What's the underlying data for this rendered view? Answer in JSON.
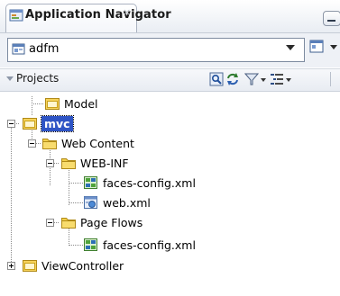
{
  "tab": {
    "title": "Application Navigator",
    "close_glyph": "×",
    "icon": "application-navigator-icon"
  },
  "app_selector": {
    "value": "adfm",
    "icon": "application-icon"
  },
  "projects_panel": {
    "title": "Projects",
    "toolbar": [
      "open-project-icon",
      "refresh-icon",
      "filter-icon",
      "sort-options-icon"
    ]
  },
  "tree": {
    "mvc": "mvc",
    "model": "Model",
    "web_content": "Web Content",
    "web_inf": "WEB-INF",
    "faces_config_1": "faces-config.xml",
    "web_xml": "web.xml",
    "page_flows": "Page Flows",
    "faces_config_2": "faces-config.xml",
    "view_controller": "ViewController"
  },
  "colors": {
    "selection": "#2f55c5",
    "folder": "#f2cf4a",
    "folder_dark": "#c9a21e"
  }
}
